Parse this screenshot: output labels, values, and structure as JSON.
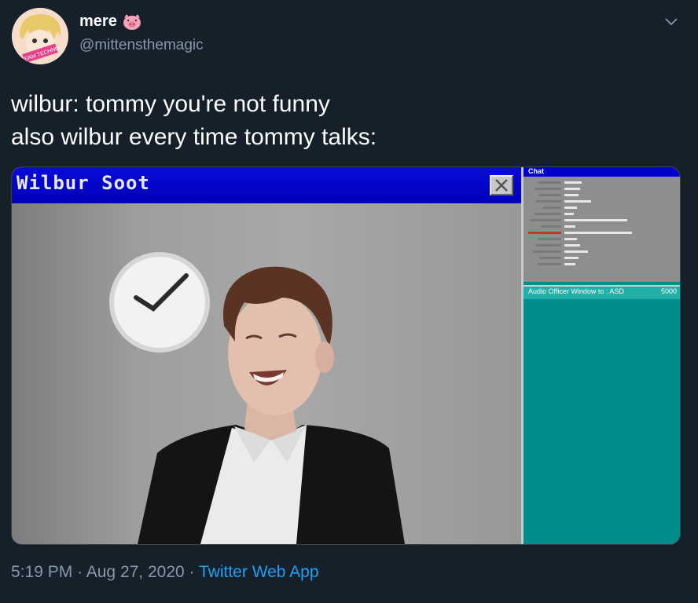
{
  "tweet": {
    "display_name": "mere",
    "name_emoji_icon": "pig-face-icon",
    "handle": "@mittensthemagic",
    "text_line1": "wilbur: tommy you're not funny",
    "text_line2": "also wilbur every time tommy talks:",
    "avatar_badge": "TEAM TECHNO",
    "time": "5:19 PM",
    "date": "Aug 27, 2020",
    "separator": "·",
    "source": "Twitter Web App"
  },
  "media": {
    "window_title": "Wilbur Soot",
    "chat_title": "Chat",
    "chat_bar_text": "Audio Officer Window to : ASD",
    "chat_bar_count": "5000"
  },
  "colors": {
    "background": "#15202b",
    "muted_text": "#8899a6",
    "link": "#1da1f2",
    "titlebar_blue": "#0000cc",
    "chat_teal": "#008c8a"
  }
}
